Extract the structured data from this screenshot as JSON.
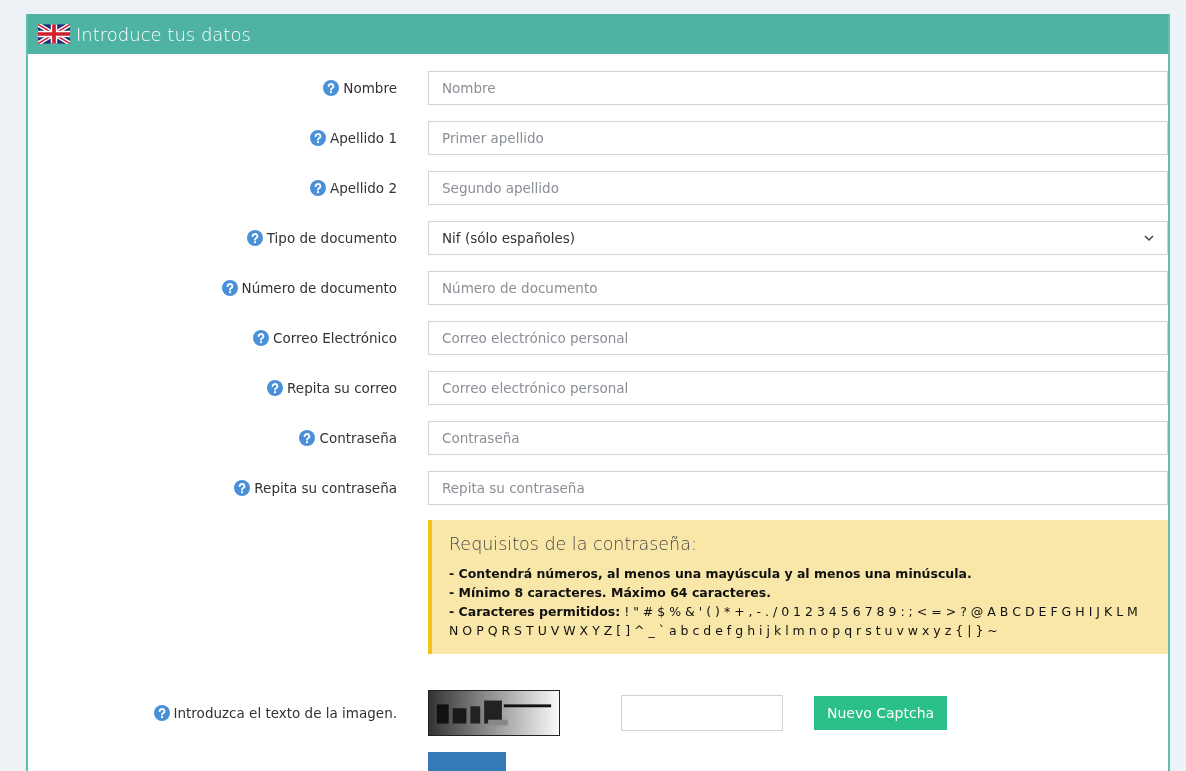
{
  "panel": {
    "title": "Introduce tus datos"
  },
  "fields": [
    {
      "kind": "input",
      "label": "Nombre",
      "placeholder": "Nombre"
    },
    {
      "kind": "input",
      "label": "Apellido 1",
      "placeholder": "Primer apellido"
    },
    {
      "kind": "input",
      "label": "Apellido 2",
      "placeholder": "Segundo apellido"
    },
    {
      "kind": "select",
      "label": "Tipo de documento",
      "value": "Nif (sólo españoles)"
    },
    {
      "kind": "input",
      "label": "Número de documento",
      "placeholder": "Número de documento"
    },
    {
      "kind": "input",
      "label": "Correo Electrónico",
      "placeholder": "Correo electrónico personal"
    },
    {
      "kind": "input",
      "label": "Repita su correo",
      "placeholder": "Correo electrónico personal"
    },
    {
      "kind": "input",
      "label": "Contraseña",
      "placeholder": "Contraseña"
    },
    {
      "kind": "input",
      "label": "Repita su contraseña",
      "placeholder": "Repita su contraseña"
    }
  ],
  "requirements": {
    "title": "Requisitos de la contraseña:",
    "lines": [
      {
        "text": "- Contendrá números, al menos una mayúscula y al menos una minúscula.",
        "bold": true
      },
      {
        "text": "- Mínimo 8 caracteres. Máximo 64 caracteres.",
        "bold": true
      },
      {
        "text": "**- Caracteres permitidos:** ! \" # $ % & ' ( ) * + , - . / 0 1 2 3 4 5 6 7 8 9 : ; < = > ? @ A B C D E F G H I J K L M N O P Q R S T U V W X Y Z [ ] ^ _ ` a b c d e f g h i j k l m n o p q r s t u v w x y z { | } ~",
        "bold": false
      }
    ]
  },
  "captcha": {
    "label": "Introduzca el texto de la imagen.",
    "refresh_button": "Nuevo Captcha"
  }
}
